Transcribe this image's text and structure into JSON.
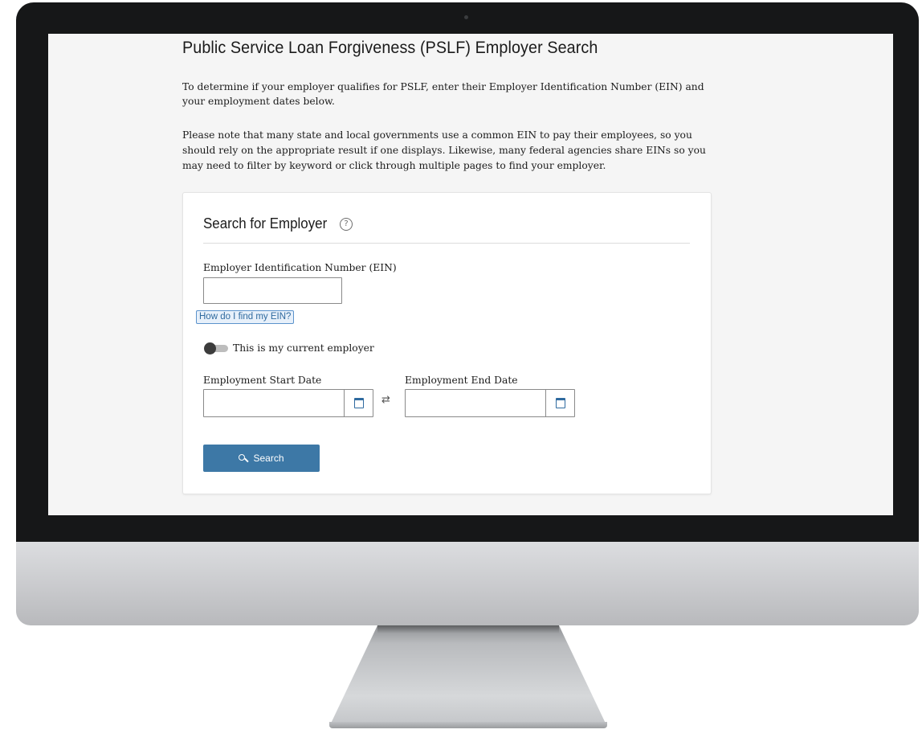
{
  "page": {
    "title": "Public Service Loan Forgiveness (PSLF) Employer Search",
    "intro": "To determine if your employer qualifies for PSLF, enter their Employer Identification Number (EIN) and your employment dates below.",
    "note": "Please note that many state and local governments use a common EIN to pay their employees, so you should rely on the appropriate result if one displays. Likewise, many federal agencies share EINs so you may need to filter by keyword or click through multiple pages to find your employer."
  },
  "search_card": {
    "title": "Search for Employer",
    "help_icon": "question-circle-icon",
    "ein_label": "Employer Identification Number (EIN)",
    "ein_value": "",
    "ein_help_link": "How do I find my EIN?",
    "current_employer_label": "This is my current employer",
    "current_employer_on": false,
    "start_date_label": "Employment Start Date",
    "start_date_value": "",
    "end_date_label": "Employment End Date",
    "end_date_value": "",
    "calendar_icon": "calendar-icon",
    "swap_icon": "swap-arrows-icon",
    "search_button": "Search",
    "search_icon": "search-icon"
  },
  "colors": {
    "primary_button": "#3d78a6",
    "link": "#2f6a9f",
    "text": "#1b1b1b",
    "bezel": "#161718"
  }
}
